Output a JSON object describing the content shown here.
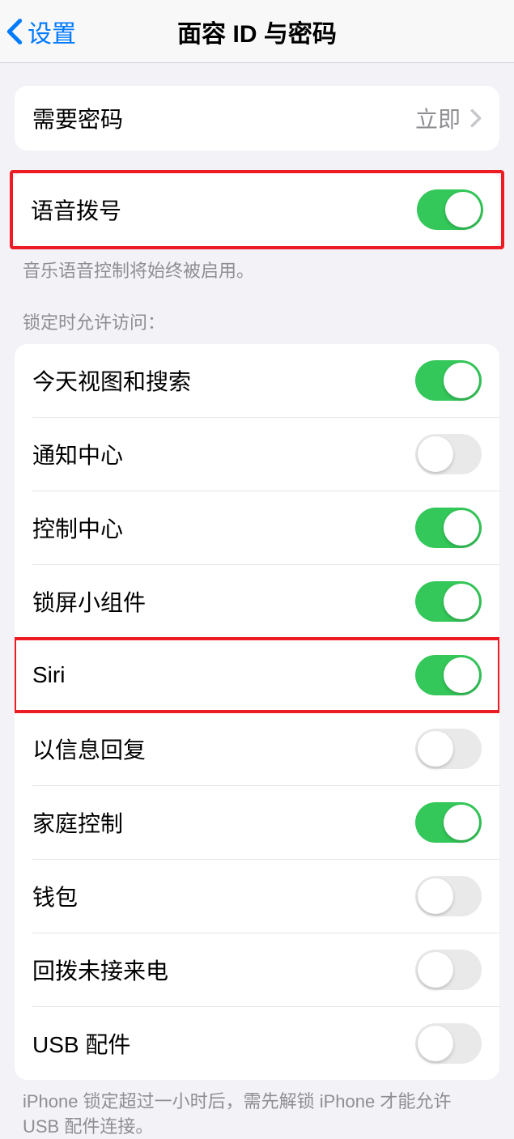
{
  "nav": {
    "back_label": "设置",
    "title": "面容 ID 与密码"
  },
  "passcode": {
    "label": "需要密码",
    "value": "立即"
  },
  "voice_dial": {
    "label": "语音拨号",
    "footer": "音乐语音控制将始终被启用。",
    "on": true
  },
  "lock_access": {
    "header": "锁定时允许访问：",
    "items": [
      {
        "label": "今天视图和搜索",
        "on": true,
        "highlighted": false
      },
      {
        "label": "通知中心",
        "on": false,
        "highlighted": false
      },
      {
        "label": "控制中心",
        "on": true,
        "highlighted": false
      },
      {
        "label": "锁屏小组件",
        "on": true,
        "highlighted": false
      },
      {
        "label": "Siri",
        "on": true,
        "highlighted": true
      },
      {
        "label": "以信息回复",
        "on": false,
        "highlighted": false
      },
      {
        "label": "家庭控制",
        "on": true,
        "highlighted": false
      },
      {
        "label": "钱包",
        "on": false,
        "highlighted": false
      },
      {
        "label": "回拨未接来电",
        "on": false,
        "highlighted": false
      },
      {
        "label": "USB 配件",
        "on": false,
        "highlighted": false
      }
    ],
    "footer": "iPhone 锁定超过一小时后，需先解锁 iPhone 才能允许 USB 配件连接。"
  }
}
